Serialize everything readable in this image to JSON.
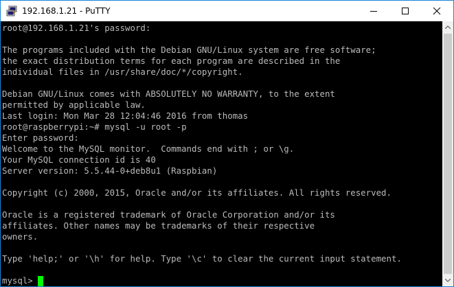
{
  "window": {
    "title": "192.168.1.21 - PuTTY",
    "icon": "putty-icon"
  },
  "controls": {
    "minimize": "minimize-icon",
    "maximize": "maximize-icon",
    "close": "close-icon"
  },
  "terminal": {
    "lines": [
      "root@192.168.1.21's password:",
      "",
      "The programs included with the Debian GNU/Linux system are free software;",
      "the exact distribution terms for each program are described in the",
      "individual files in /usr/share/doc/*/copyright.",
      "",
      "Debian GNU/Linux comes with ABSOLUTELY NO WARRANTY, to the extent",
      "permitted by applicable law.",
      "Last login: Mon Mar 28 12:04:46 2016 from thomas",
      "root@raspberrypi:~# mysql -u root -p",
      "Enter password:",
      "Welcome to the MySQL monitor.  Commands end with ; or \\g.",
      "Your MySQL connection id is 40",
      "Server version: 5.5.44-0+deb8u1 (Raspbian)",
      "",
      "Copyright (c) 2000, 2015, Oracle and/or its affiliates. All rights reserved.",
      "",
      "Oracle is a registered trademark of Oracle Corporation and/or its",
      "affiliates. Other names may be trademarks of their respective",
      "owners.",
      "",
      "Type 'help;' or '\\h' for help. Type '\\c' to clear the current input statement.",
      ""
    ],
    "prompt": "mysql> ",
    "cursor_color": "#00ff00",
    "text_color": "#bbbbbb",
    "background": "#000000"
  },
  "scrollbar": {
    "up": "scroll-up-arrow-icon",
    "down": "scroll-down-arrow-icon"
  }
}
